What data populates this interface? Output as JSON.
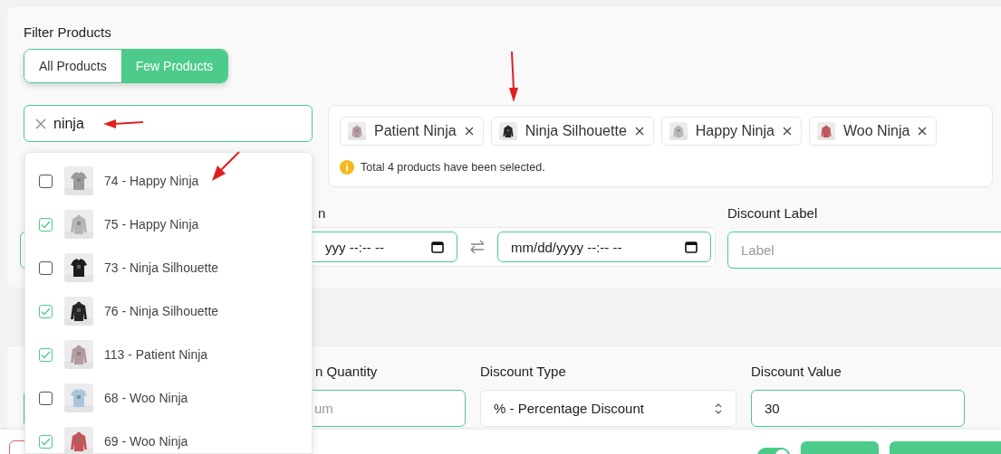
{
  "filter": {
    "title": "Filter Products",
    "tabs": [
      {
        "label": "All Products",
        "selected": false
      },
      {
        "label": "Few Products",
        "selected": true
      }
    ],
    "search": {
      "value": "ninja"
    },
    "results": [
      {
        "label": "74 - Happy Ninja",
        "checked": false
      },
      {
        "label": "75 - Happy Ninja",
        "checked": true
      },
      {
        "label": "73 - Ninja Silhouette",
        "checked": false
      },
      {
        "label": "76 - Ninja Silhouette",
        "checked": true
      },
      {
        "label": "113 - Patient Ninja",
        "checked": true
      },
      {
        "label": "68 - Woo Ninja",
        "checked": false
      },
      {
        "label": "69 - Woo Ninja",
        "checked": true
      }
    ],
    "selected_tags": [
      {
        "label": "Patient Ninja"
      },
      {
        "label": "Ninja Silhouette"
      },
      {
        "label": "Happy Ninja"
      },
      {
        "label": "Woo Ninja"
      }
    ],
    "notice": "Total 4 products have been selected."
  },
  "schedule": {
    "label_2": "n",
    "start_value": "yyy --:-- --",
    "end_value": "mm/dd/yyyy --:-- --",
    "discount_label": "Discount Label",
    "discount_placeholder": "Label"
  },
  "discount": {
    "quantity_label": "n Quantity",
    "quantity_placeholder": "um",
    "type_label": "Discount Type",
    "type_value": "% - Percentage Discount",
    "value_label": "Discount Value",
    "value": "30"
  },
  "footer": {
    "toggle_on": true
  }
}
